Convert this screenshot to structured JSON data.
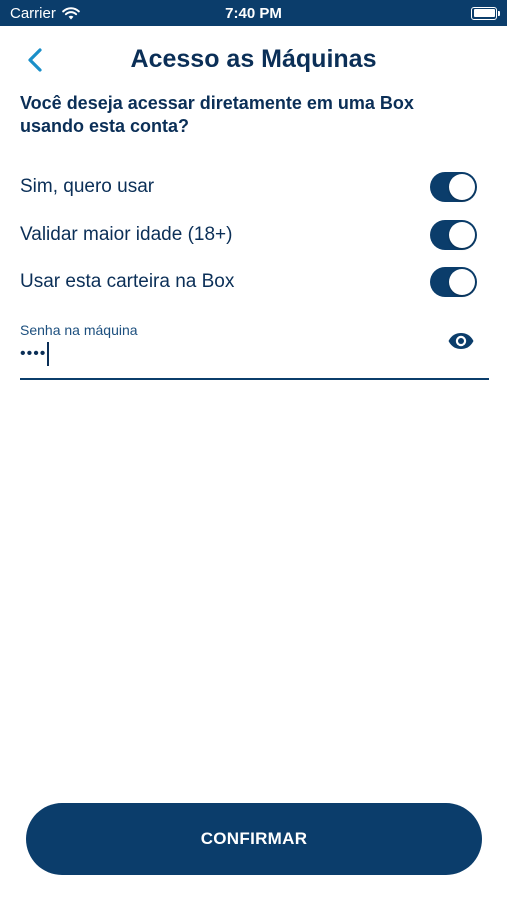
{
  "status_bar": {
    "carrier": "Carrier",
    "time": "7:40 PM",
    "wifi_icon": "wifi-icon",
    "battery_icon": "battery-icon"
  },
  "nav": {
    "title": "Acesso as Máquinas",
    "back_icon": "chevron-left-icon"
  },
  "question": "Você deseja acessar diretamente em uma Box usando esta conta?",
  "options": [
    {
      "label": "Sim, quero usar",
      "on": true
    },
    {
      "label": "Validar maior idade (18+)",
      "on": true
    },
    {
      "label": "Usar esta carteira na Box",
      "on": true
    }
  ],
  "password_field": {
    "label": "Senha na máquina",
    "value": "••••",
    "toggle_icon": "eye-icon"
  },
  "confirm_label": "CONFIRMAR",
  "colors": {
    "primary": "#0b3d6b",
    "text": "#0b2f57",
    "accent": "#1a8fc9",
    "background": "#ffffff"
  }
}
